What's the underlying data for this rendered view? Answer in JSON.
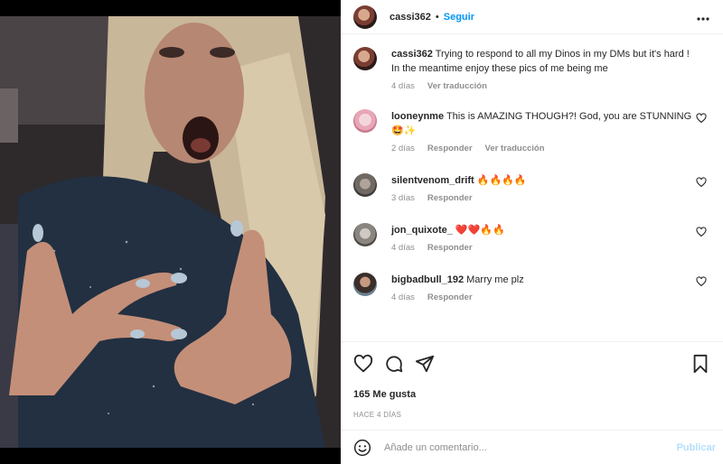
{
  "post": {
    "username": "cassi362",
    "follow_separator": "•",
    "follow_label": "Seguir",
    "more_label": "···",
    "caption": {
      "username": "cassi362",
      "text": "Trying to respond to all my Dinos in my DMs but it's hard ! In the meantime enjoy these pics of me being me",
      "time": "4 días",
      "translate": "Ver traducción"
    },
    "comments": [
      {
        "username": "looneynme",
        "text": "This is AMAZING THOUGH?! God, you are STUNNING 🤩✨",
        "time": "2 días",
        "reply": "Responder",
        "translate": "Ver traducción"
      },
      {
        "username": "silentvenom_drift",
        "text": "🔥🔥🔥🔥",
        "time": "3 días",
        "reply": "Responder"
      },
      {
        "username": "jon_quixote_",
        "text": "❤️❤️🔥🔥",
        "time": "4 días",
        "reply": "Responder"
      },
      {
        "username": "bigbadbull_192",
        "text": "Marry me plz",
        "time": "4 días",
        "reply": "Responder"
      }
    ],
    "likes": "165 Me gusta",
    "posted_ago": "HACE 4 DÍAS",
    "add_comment_placeholder": "Añade un comentario...",
    "publish_label": "Publicar"
  },
  "icons": {
    "like": "heart-icon",
    "comment": "comment-icon",
    "share": "share-icon",
    "save": "bookmark-icon",
    "emoji": "emoji-icon",
    "more": "more-icon"
  },
  "colors": {
    "accent": "#0095f6",
    "publish_disabled": "#b2dffc",
    "muted": "#8e8e8e",
    "text": "#262626"
  }
}
